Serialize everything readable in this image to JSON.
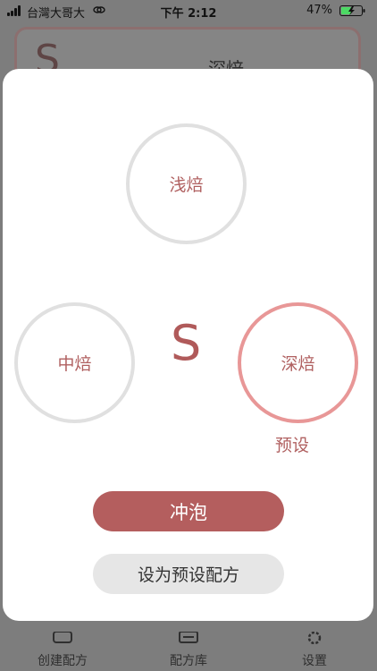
{
  "status_bar": {
    "carrier": "台灣大哥大",
    "time": "下午 2:12",
    "battery": "47%"
  },
  "background": {
    "card_letter": "S",
    "card_label": "深焙",
    "nav": [
      {
        "label": "创建配方",
        "icon": "edit-icon"
      },
      {
        "label": "配方库",
        "icon": "library-icon"
      },
      {
        "label": "设置",
        "icon": "gear-icon"
      }
    ]
  },
  "modal": {
    "options": [
      {
        "label": "浅焙",
        "selected": false
      },
      {
        "label": "中焙",
        "selected": false
      },
      {
        "label": "深焙",
        "selected": true
      }
    ],
    "size_letter": "S",
    "preset_label": "预设",
    "brew_button": "冲泡",
    "set_default_button": "设为预设配方"
  },
  "colors": {
    "accent": "#b45e5e",
    "selected_ring": "#e89797",
    "ring": "#e0e0e0"
  }
}
